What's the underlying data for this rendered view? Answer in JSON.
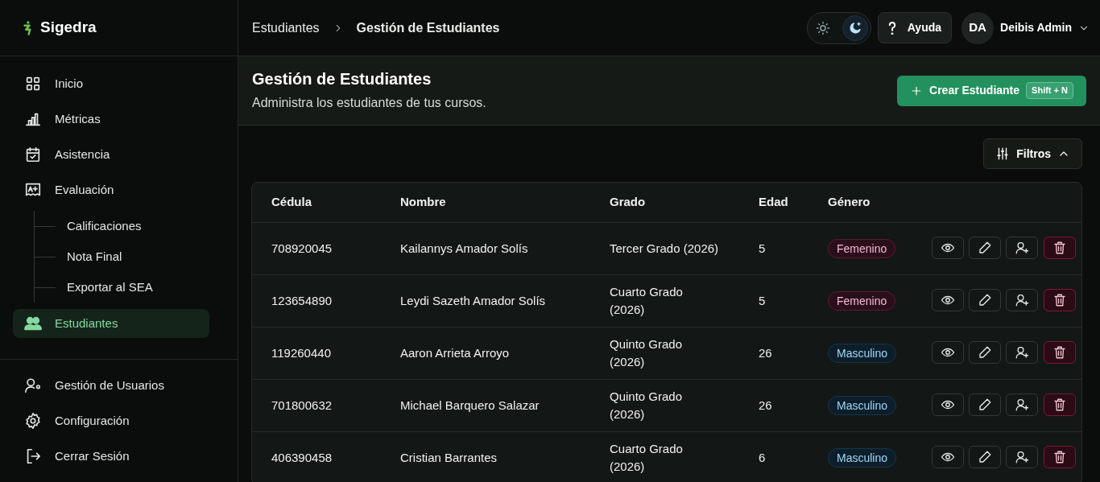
{
  "brand": "Sigedra",
  "nav": [
    {
      "label": "Inicio",
      "selected": false
    },
    {
      "label": "Métricas",
      "selected": false
    },
    {
      "label": "Asistencia",
      "selected": false
    },
    {
      "label": "Evaluación",
      "selected": false,
      "children": [
        {
          "label": "Calificaciones"
        },
        {
          "label": "Nota Final"
        },
        {
          "label": "Exportar al SEA"
        }
      ]
    },
    {
      "label": "Estudiantes",
      "selected": true
    }
  ],
  "nav_bottom": [
    {
      "label": "Gestión de Usuarios"
    },
    {
      "label": "Configuración"
    },
    {
      "label": "Cerrar Sesión"
    }
  ],
  "breadcrumb": [
    "Estudiantes",
    "Gestión de Estudiantes"
  ],
  "theme": [
    {
      "kind": "light",
      "selected": false
    },
    {
      "kind": "dark",
      "selected": true
    }
  ],
  "help_button": "Ayuda",
  "user": {
    "initials": "DA",
    "name": "Deibis Admin"
  },
  "page": {
    "title": "Gestión de Estudiantes",
    "subtitle": "Administra los estudiantes de tus cursos.",
    "create_button": "Crear Estudiante",
    "shortcut": "Shift + N"
  },
  "filters": {
    "label": "Filtros",
    "expanded": true
  },
  "table": {
    "columns": [
      "Cédula",
      "Nombre",
      "Grado",
      "Edad",
      "Género"
    ],
    "rows": [
      {
        "id": "708920045",
        "name": "Kailannys Amador Solís",
        "grade": "Tercer Grado (2026)",
        "age": "5",
        "gender": "Femenino",
        "kind": "female"
      },
      {
        "id": "123654890",
        "name": "Leydi Sazeth Amador Solís",
        "grade": "Cuarto Grado (2026)",
        "age": "5",
        "gender": "Femenino",
        "kind": "female"
      },
      {
        "id": "119260440",
        "name": "Aaron Arrieta Arroyo",
        "grade": "Quinto Grado (2026)",
        "age": "26",
        "gender": "Masculino",
        "kind": "male"
      },
      {
        "id": "701800632",
        "name": "Michael Barquero Salazar",
        "grade": "Quinto Grado (2026)",
        "age": "26",
        "gender": "Masculino",
        "kind": "male"
      },
      {
        "id": "406390458",
        "name": "Cristian Barrantes",
        "grade": "Cuarto Grado (2026)",
        "age": "6",
        "gender": "Masculino",
        "kind": "male"
      }
    ]
  }
}
